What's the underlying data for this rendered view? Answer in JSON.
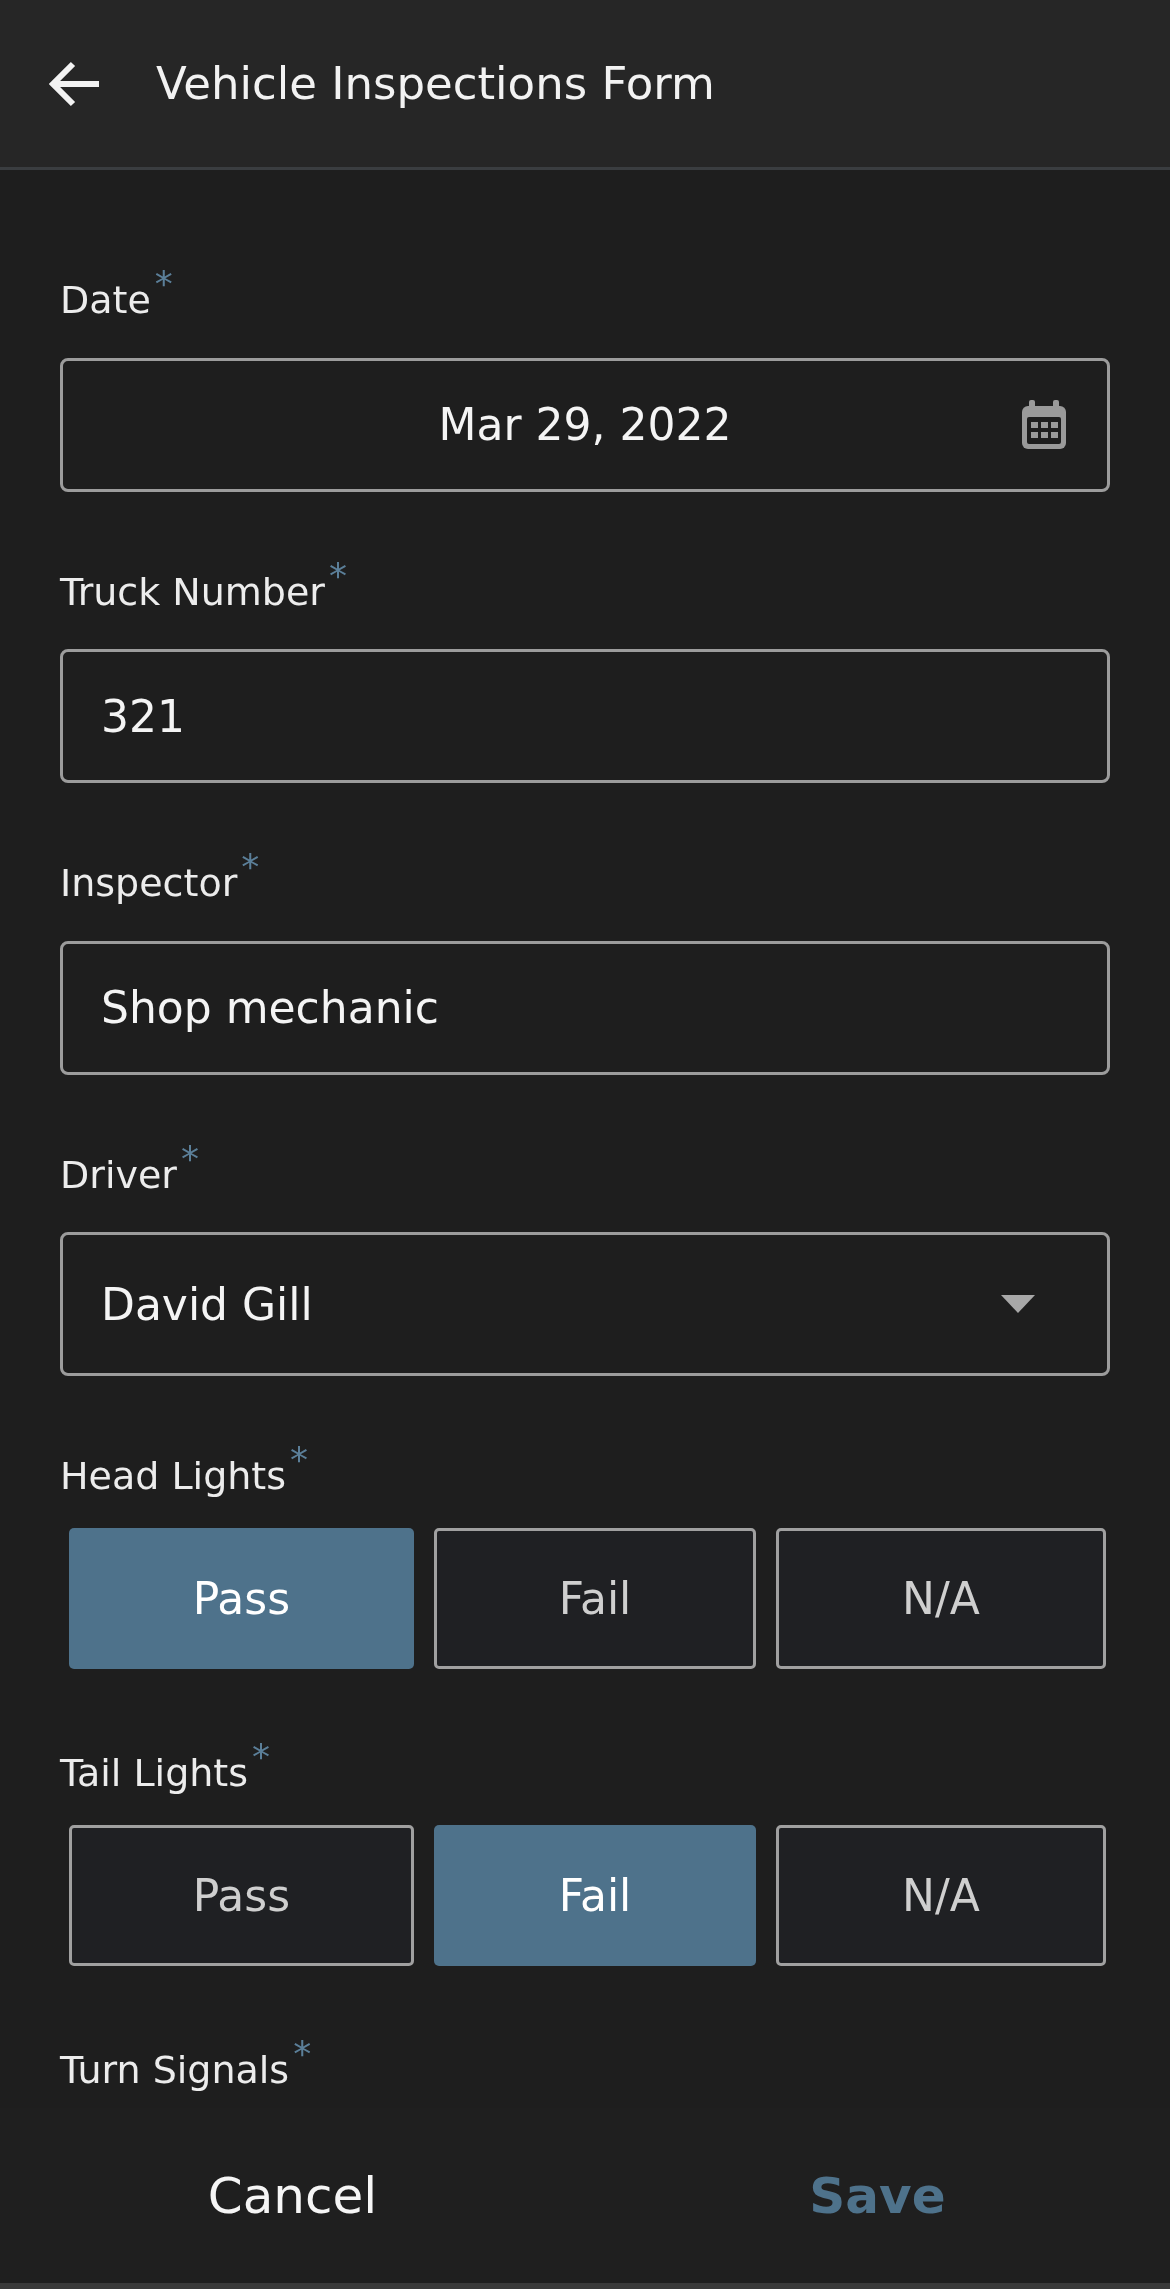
{
  "header": {
    "title": "Vehicle Inspections Form"
  },
  "fields": [
    {
      "kind": "date",
      "label": "Date",
      "required_mark": "*",
      "value": "Mar 29, 2022"
    },
    {
      "kind": "text",
      "label": "Truck Number",
      "required_mark": "*",
      "value": "321"
    },
    {
      "kind": "text",
      "label": "Inspector",
      "required_mark": "*",
      "value": "Shop mechanic"
    },
    {
      "kind": "select",
      "label": "Driver",
      "required_mark": "*",
      "value": "David Gill"
    },
    {
      "kind": "choice",
      "label": "Head Lights",
      "required_mark": "*",
      "options": [
        {
          "label": "Pass",
          "selected": true
        },
        {
          "label": "Fail",
          "selected": false
        },
        {
          "label": "N/A",
          "selected": false
        }
      ]
    },
    {
      "kind": "choice",
      "label": "Tail Lights",
      "required_mark": "*",
      "options": [
        {
          "label": "Pass",
          "selected": false
        },
        {
          "label": "Fail",
          "selected": true
        },
        {
          "label": "N/A",
          "selected": false
        }
      ]
    },
    {
      "kind": "label",
      "label": "Turn Signals",
      "required_mark": "*"
    }
  ],
  "footer": {
    "cancel": "Cancel",
    "save": "Save"
  }
}
